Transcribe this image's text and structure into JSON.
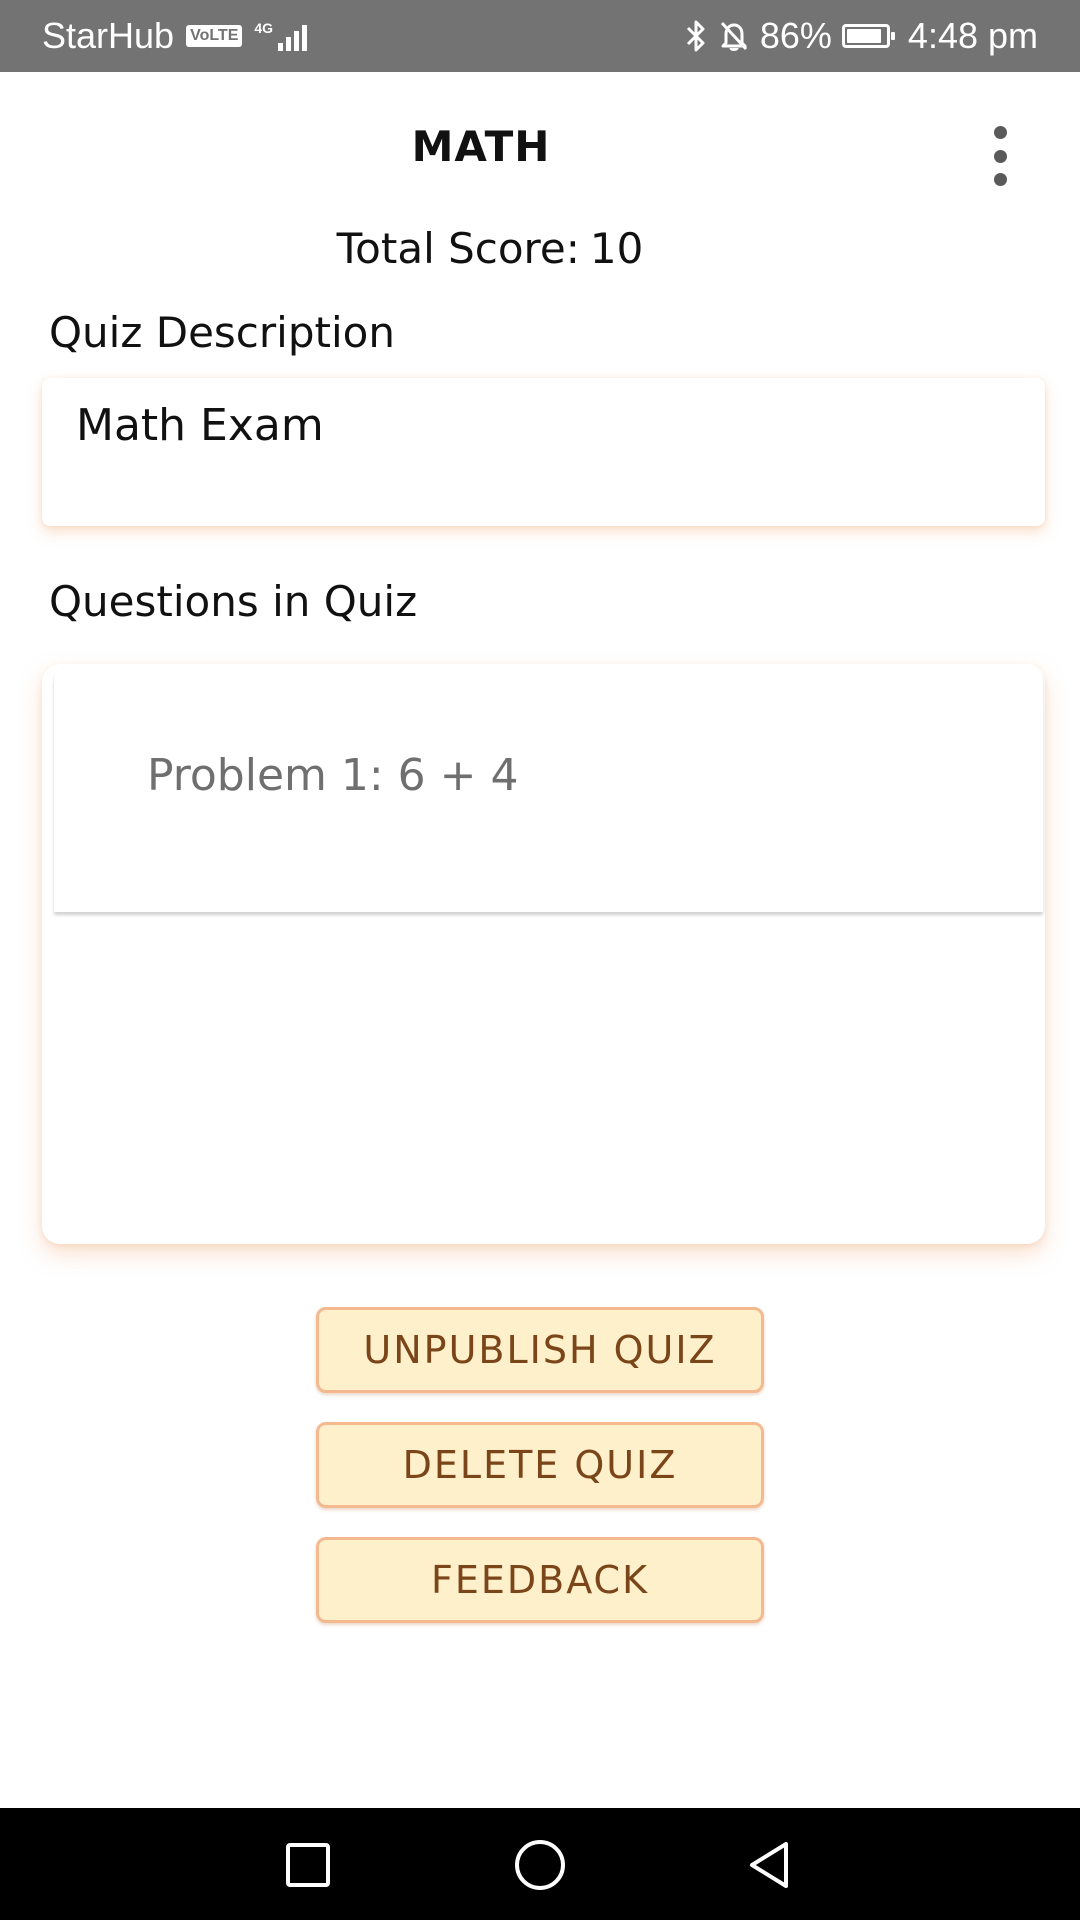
{
  "status_bar": {
    "carrier": "StarHub",
    "volte": "VoLTE",
    "network": "4G",
    "battery_percent": "86%",
    "battery_level": 0.86,
    "time": "4:48 pm",
    "icons": [
      "bluetooth-icon",
      "notifications-off-icon",
      "battery-icon",
      "signal-icon"
    ]
  },
  "app_bar": {
    "title": "MATH",
    "menu_icon": "more-vert-icon"
  },
  "score": {
    "label": "Total Score:",
    "value": "10"
  },
  "description": {
    "label": "Quiz Description",
    "value": "Math Exam"
  },
  "questions": {
    "label": "Questions in Quiz",
    "items": [
      {
        "text": "Problem 1: 6 + 4"
      }
    ]
  },
  "actions": {
    "unpublish": "UNPUBLISH QUIZ",
    "delete": "DELETE QUIZ",
    "feedback": "FEEDBACK"
  },
  "nav_bar": {
    "icons": [
      "recents-icon",
      "home-icon",
      "back-icon"
    ]
  },
  "colors": {
    "status_bar": "#737373",
    "button_fill": "#fff0cc",
    "button_border": "#f4b98e",
    "button_text": "#7a4518",
    "card_shadow": "#f0aa78"
  }
}
